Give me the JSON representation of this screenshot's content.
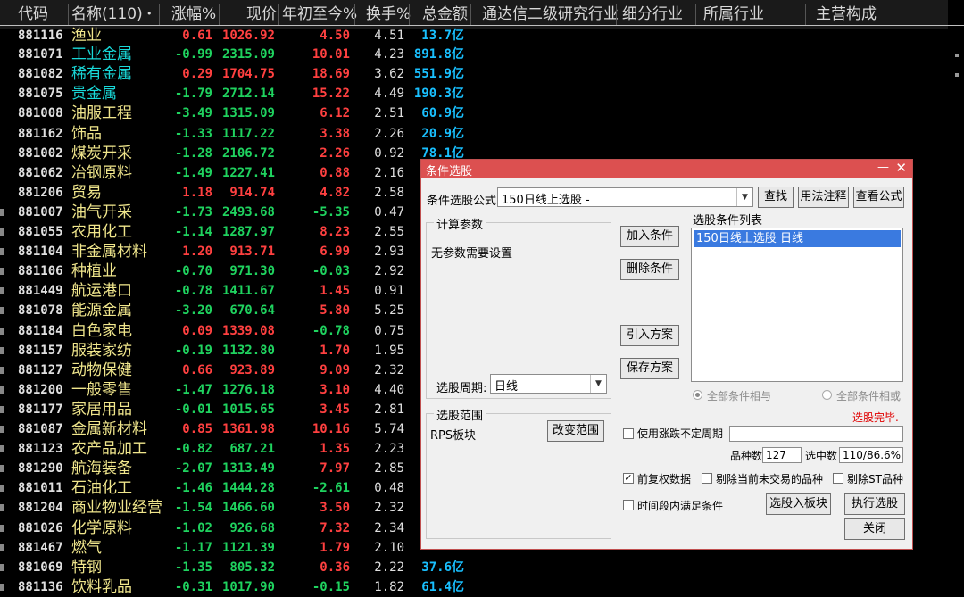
{
  "header": {
    "code": "代码",
    "name": "名称(110)",
    "name_marker": "•",
    "change": "涨幅%",
    "price": "现价",
    "ytd": "年初至今%",
    "turnover": "换手%",
    "amount": "总金额",
    "tdx_industry": "通达信二级研究行业",
    "sub_industry": "细分行业",
    "industry": "所属行业",
    "business": "主营构成"
  },
  "rows": [
    {
      "code": "881116",
      "name": "渔业",
      "chg": "0.61",
      "price": "1026.92",
      "ytd": "4.50",
      "turn": "4.51",
      "amt": "13.7亿",
      "name_color": "yellow",
      "chg_dir": "up",
      "ytd_dir": "up"
    },
    {
      "code": "881071",
      "name": "工业金属",
      "chg": "-0.99",
      "price": "2315.09",
      "ytd": "10.01",
      "turn": "4.23",
      "amt": "891.8亿",
      "name_color": "cyan",
      "chg_dir": "down",
      "ytd_dir": "up"
    },
    {
      "code": "881082",
      "name": "稀有金属",
      "chg": "0.29",
      "price": "1704.75",
      "ytd": "18.69",
      "turn": "3.62",
      "amt": "551.9亿",
      "name_color": "cyan",
      "chg_dir": "up",
      "ytd_dir": "up"
    },
    {
      "code": "881075",
      "name": "贵金属",
      "chg": "-1.79",
      "price": "2712.14",
      "ytd": "15.22",
      "turn": "4.49",
      "amt": "190.3亿",
      "name_color": "cyan",
      "chg_dir": "down",
      "ytd_dir": "up"
    },
    {
      "code": "881008",
      "name": "油服工程",
      "chg": "-3.49",
      "price": "1315.09",
      "ytd": "6.12",
      "turn": "2.51",
      "amt": "60.9亿",
      "name_color": "yellow",
      "chg_dir": "down",
      "ytd_dir": "up"
    },
    {
      "code": "881162",
      "name": "饰品",
      "chg": "-1.33",
      "price": "1117.22",
      "ytd": "3.38",
      "turn": "2.26",
      "amt": "20.9亿",
      "name_color": "yellow",
      "chg_dir": "down",
      "ytd_dir": "up"
    },
    {
      "code": "881002",
      "name": "煤炭开采",
      "chg": "-1.28",
      "price": "2106.72",
      "ytd": "2.26",
      "turn": "0.92",
      "amt": "78.1亿",
      "name_color": "yellow",
      "chg_dir": "down",
      "ytd_dir": "up"
    },
    {
      "code": "881062",
      "name": "冶钢原料",
      "chg": "-1.49",
      "price": "1227.41",
      "ytd": "0.88",
      "turn": "2.16",
      "amt": "",
      "name_color": "yellow",
      "chg_dir": "down",
      "ytd_dir": "up"
    },
    {
      "code": "881206",
      "name": "贸易",
      "chg": "1.18",
      "price": "914.74",
      "ytd": "4.82",
      "turn": "2.58",
      "amt": "",
      "name_color": "yellow",
      "chg_dir": "up",
      "ytd_dir": "up"
    },
    {
      "code": "881007",
      "name": "油气开采",
      "chg": "-1.73",
      "price": "2493.68",
      "ytd": "-5.35",
      "turn": "0.47",
      "amt": "",
      "name_color": "yellow",
      "chg_dir": "down",
      "ytd_dir": "down"
    },
    {
      "code": "881055",
      "name": "农用化工",
      "chg": "-1.14",
      "price": "1287.97",
      "ytd": "8.23",
      "turn": "2.55",
      "amt": "",
      "name_color": "yellow",
      "chg_dir": "down",
      "ytd_dir": "up"
    },
    {
      "code": "881104",
      "name": "非金属材料",
      "chg": "1.20",
      "price": "913.71",
      "ytd": "6.99",
      "turn": "2.93",
      "amt": "",
      "name_color": "yellow",
      "chg_dir": "up",
      "ytd_dir": "up"
    },
    {
      "code": "881106",
      "name": "种植业",
      "chg": "-0.70",
      "price": "971.30",
      "ytd": "-0.03",
      "turn": "2.92",
      "amt": "",
      "name_color": "yellow",
      "chg_dir": "down",
      "ytd_dir": "down"
    },
    {
      "code": "881449",
      "name": "航运港口",
      "chg": "-0.78",
      "price": "1411.67",
      "ytd": "1.45",
      "turn": "0.91",
      "amt": "",
      "name_color": "yellow",
      "chg_dir": "down",
      "ytd_dir": "up"
    },
    {
      "code": "881078",
      "name": "能源金属",
      "chg": "-3.20",
      "price": "670.64",
      "ytd": "5.80",
      "turn": "5.25",
      "amt": "",
      "name_color": "yellow",
      "chg_dir": "down",
      "ytd_dir": "up"
    },
    {
      "code": "881184",
      "name": "白色家电",
      "chg": "0.09",
      "price": "1339.08",
      "ytd": "-0.78",
      "turn": "0.75",
      "amt": "",
      "name_color": "yellow",
      "chg_dir": "up",
      "ytd_dir": "down"
    },
    {
      "code": "881157",
      "name": "服装家纺",
      "chg": "-0.19",
      "price": "1132.80",
      "ytd": "1.70",
      "turn": "1.95",
      "amt": "",
      "name_color": "yellow",
      "chg_dir": "down",
      "ytd_dir": "up"
    },
    {
      "code": "881127",
      "name": "动物保健",
      "chg": "0.66",
      "price": "923.89",
      "ytd": "9.09",
      "turn": "2.32",
      "amt": "",
      "name_color": "yellow",
      "chg_dir": "up",
      "ytd_dir": "up"
    },
    {
      "code": "881200",
      "name": "一般零售",
      "chg": "-1.47",
      "price": "1276.18",
      "ytd": "3.10",
      "turn": "4.40",
      "amt": "",
      "name_color": "yellow",
      "chg_dir": "down",
      "ytd_dir": "up"
    },
    {
      "code": "881177",
      "name": "家居用品",
      "chg": "-0.01",
      "price": "1015.65",
      "ytd": "3.45",
      "turn": "2.81",
      "amt": "",
      "name_color": "yellow",
      "chg_dir": "down",
      "ytd_dir": "up"
    },
    {
      "code": "881087",
      "name": "金属新材料",
      "chg": "0.85",
      "price": "1361.98",
      "ytd": "10.16",
      "turn": "5.74",
      "amt": "",
      "name_color": "yellow",
      "chg_dir": "up",
      "ytd_dir": "up"
    },
    {
      "code": "881123",
      "name": "农产品加工",
      "chg": "-0.82",
      "price": "687.21",
      "ytd": "1.35",
      "turn": "2.23",
      "amt": "",
      "name_color": "yellow",
      "chg_dir": "down",
      "ytd_dir": "up"
    },
    {
      "code": "881290",
      "name": "航海装备",
      "chg": "-2.07",
      "price": "1313.49",
      "ytd": "7.97",
      "turn": "2.85",
      "amt": "",
      "name_color": "yellow",
      "chg_dir": "down",
      "ytd_dir": "up"
    },
    {
      "code": "881011",
      "name": "石油化工",
      "chg": "-1.46",
      "price": "1444.28",
      "ytd": "-2.61",
      "turn": "0.48",
      "amt": "",
      "name_color": "yellow",
      "chg_dir": "down",
      "ytd_dir": "down"
    },
    {
      "code": "881204",
      "name": "商业物业经营",
      "chg": "-1.54",
      "price": "1466.60",
      "ytd": "3.50",
      "turn": "2.32",
      "amt": "",
      "name_color": "yellow",
      "chg_dir": "down",
      "ytd_dir": "up"
    },
    {
      "code": "881026",
      "name": "化学原料",
      "chg": "-1.02",
      "price": "926.68",
      "ytd": "7.32",
      "turn": "2.34",
      "amt": "",
      "name_color": "yellow",
      "chg_dir": "down",
      "ytd_dir": "up"
    },
    {
      "code": "881467",
      "name": "燃气",
      "chg": "-1.17",
      "price": "1121.39",
      "ytd": "1.79",
      "turn": "2.10",
      "amt": "",
      "name_color": "yellow",
      "chg_dir": "down",
      "ytd_dir": "up"
    },
    {
      "code": "881069",
      "name": "特钢",
      "chg": "-1.35",
      "price": "805.32",
      "ytd": "0.36",
      "turn": "2.22",
      "amt": "37.6亿",
      "name_color": "yellow",
      "chg_dir": "down",
      "ytd_dir": "up"
    },
    {
      "code": "881136",
      "name": "饮料乳品",
      "chg": "-0.31",
      "price": "1017.90",
      "ytd": "-0.15",
      "turn": "1.82",
      "amt": "61.4亿",
      "name_color": "yellow",
      "chg_dir": "down",
      "ytd_dir": "down"
    }
  ],
  "dialog": {
    "title": "条件选股",
    "minimize": "—",
    "close": "✕",
    "formula_label": "条件选股公式",
    "formula_value": "150日线上选股 -",
    "find_btn": "查找",
    "usage_btn": "用法注释",
    "view_formula_btn": "查看公式",
    "calc_params_title": "计算参数",
    "no_params_text": "无参数需要设置",
    "period_label": "选股周期:",
    "period_value": "日线",
    "add_condition_btn": "加入条件",
    "delete_condition_btn": "删除条件",
    "import_plan_btn": "引入方案",
    "save_plan_btn": "保存方案",
    "condition_list_title": "选股条件列表",
    "condition_items": [
      "150日线上选股  日线"
    ],
    "radio_and": "全部条件相与",
    "radio_or": "全部条件相或",
    "status_text": "选股完毕.",
    "scope_title": "选股范围",
    "scope_value": "RPS板块",
    "change_scope_btn": "改变范围",
    "use_uncertain_period": "使用涨跌不定周期",
    "stock_count_label": "品种数",
    "stock_count_value": "127",
    "selected_label": "选中数",
    "selected_value": "110/86.6%",
    "forward_adjust": "前复权数据",
    "exclude_untraded": "剔除当前未交易的品种",
    "exclude_st": "剔除ST品种",
    "period_satisfy": "时间段内满足条件",
    "to_block_btn": "选股入板块",
    "execute_btn": "执行选股",
    "close_btn": "关闭"
  }
}
